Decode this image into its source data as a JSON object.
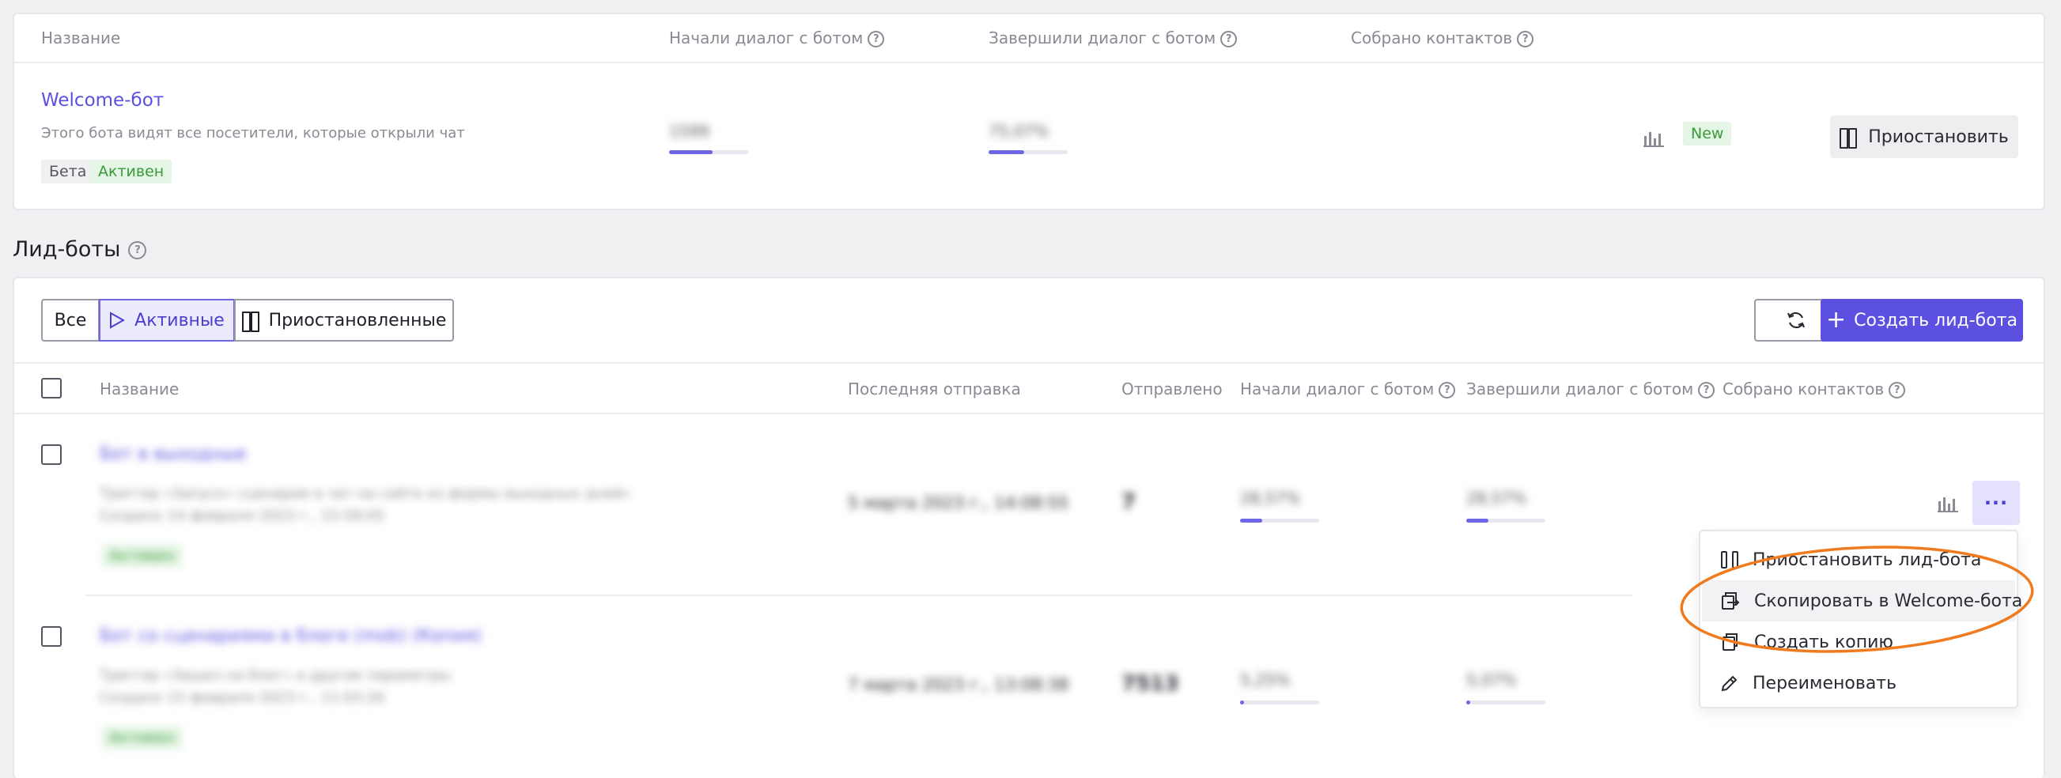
{
  "welcome": {
    "headers": {
      "name": "Название",
      "started": "Начали диалог с ботом",
      "finished": "Завершили диалог с ботом",
      "contacts": "Собрано контактов"
    },
    "help_glyph": "?",
    "bot_name": "Welcome-бот",
    "bot_desc": "Этого бота видят все посетители, которые открыли чат",
    "tag_beta": "Бета",
    "tag_active": "Активен",
    "started_value": "1599",
    "started_fraction": 0.55,
    "finished_value": "75,07%",
    "finished_fraction": 0.45,
    "new_badge": "New",
    "pause_button": "Приостановить",
    "stats_icon": "bar-chart-icon"
  },
  "leadbots": {
    "section_title": "Лид-боты",
    "filters": {
      "all": "Все",
      "active": "Активные",
      "paused": "Приостановленные"
    },
    "refresh_icon": "refresh-icon",
    "create_button": "Создать лид-бота",
    "headers": {
      "name": "Название",
      "last_sent": "Последняя отправка",
      "sent": "Отправлено",
      "started": "Начали диалог с ботом",
      "finished": "Завершили диалог с ботом",
      "contacts": "Собрано контактов"
    },
    "rows": [
      {
        "name": "Бот в выходные",
        "trigger": "Триггер «Запуск» сценарии в чат на сайте из формы выходных дней»",
        "created": "Создано 14 февраля 2023 г., 15:59:05",
        "status": "Активен",
        "last_sent": "5 марта 2023 г., 14:08:55",
        "sent": "7",
        "started": "28,57%",
        "started_fraction": 0.28,
        "finished": "28,57%",
        "finished_fraction": 0.28
      },
      {
        "name": "Бот со сценариями в блоге (mob) (Копия)",
        "trigger": "Триггер «Зашел на блог» и другие параметры",
        "created": "Создано 15 февраля 2023 г., 11:03:26",
        "status": "Активен",
        "last_sent": "7 марта 2023 г., 13:08:38",
        "sent": "7513",
        "started": "5,25%",
        "started_fraction": 0.05,
        "finished": "5,07%",
        "finished_fraction": 0.05
      }
    ],
    "row_menu": {
      "trigger_glyph": "···",
      "items": [
        {
          "label": "Приостановить лид-бота",
          "icon": "pause-icon"
        },
        {
          "label": "Скопировать в Welcome-бота",
          "icon": "copy-export-icon"
        },
        {
          "label": "Создать копию",
          "icon": "duplicate-icon"
        },
        {
          "label": "Переименовать",
          "icon": "pencil-icon"
        }
      ]
    }
  },
  "colors": {
    "accent": "#5b50e0",
    "link": "#5b50e0",
    "active_green": "#3a9a3a",
    "highlight_ring": "#f07b1f"
  }
}
